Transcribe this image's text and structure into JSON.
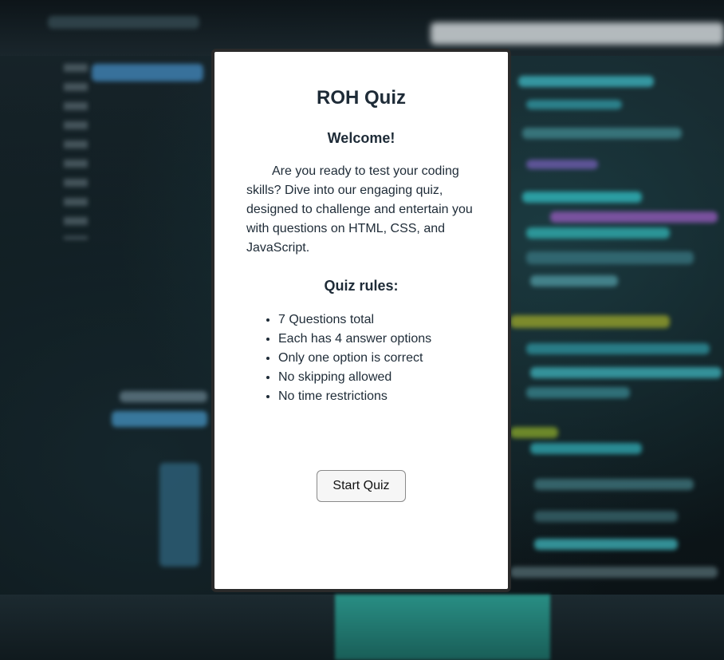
{
  "quiz": {
    "title": "ROH Quiz",
    "welcome": "Welcome!",
    "intro": "Are you ready to test your coding skills? Dive into our engaging quiz, designed to challenge and entertain you with questions on HTML, CSS, and JavaScript.",
    "rules_heading": "Quiz rules:",
    "rules": [
      "7 Questions total",
      "Each has 4 answer options",
      "Only one option is correct",
      "No skipping allowed",
      "No time restrictions"
    ],
    "start_label": "Start Quiz"
  },
  "colors": {
    "card_background": "#ffffff",
    "text": "#1e2b37",
    "card_border": "#2a2a2a",
    "page_background": "#0d1519"
  }
}
